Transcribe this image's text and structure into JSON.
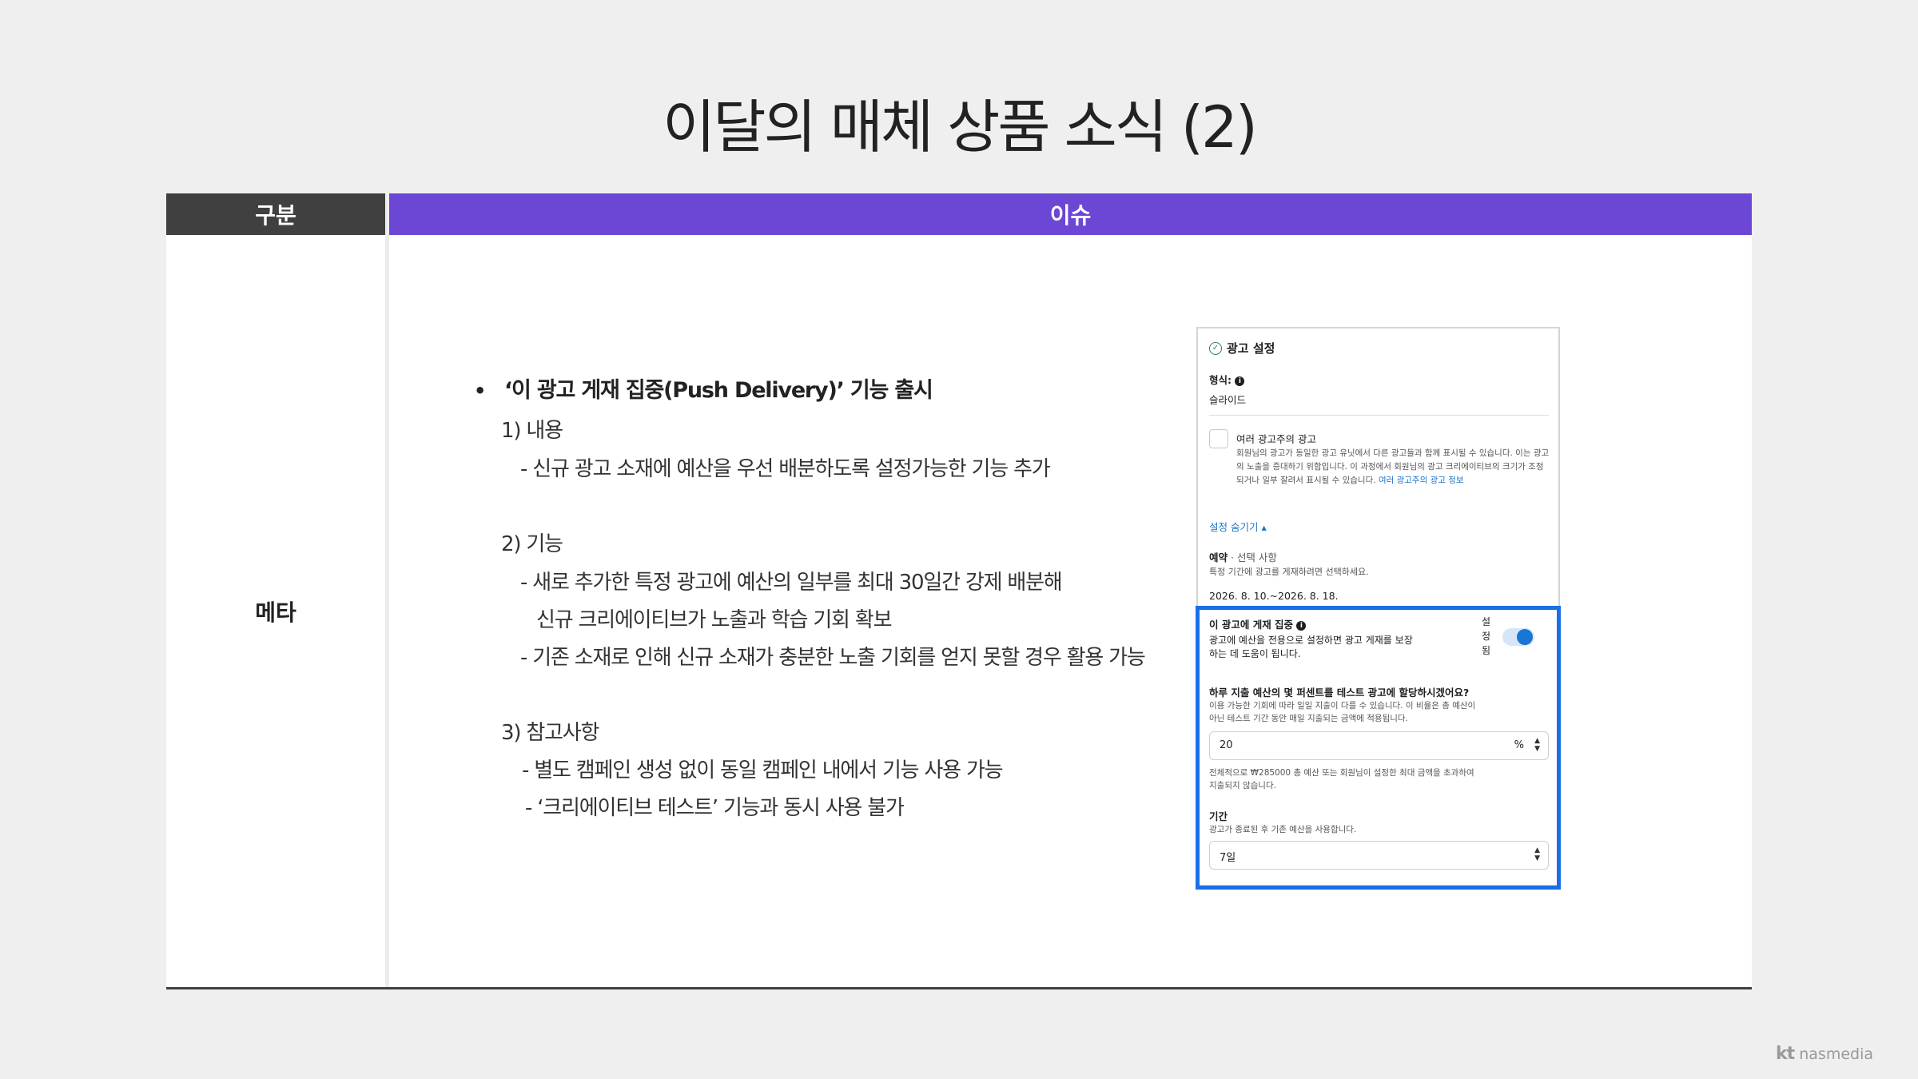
{
  "title": "이달의 매체 상품 소식 (2)",
  "table": {
    "header_left": "구분",
    "header_right": "이슈",
    "row_label": "메타"
  },
  "body": {
    "bullet_title": "‘이 광고 게재 집중(Push Delivery)’ 기능 출시",
    "sec1_title": "1) 내용",
    "sec1_item1": "- 신규 광고 소재에 예산을 우선 배분하도록 설정가능한 기능 추가",
    "sec2_title": "2) 기능",
    "sec2_item1a": "- 새로 추가한 특정 광고에 예산의 일부를 최대 30일간 강제 배분해",
    "sec2_item1b": "신규 크리에이티브가 노출과 학습 기회 확보",
    "sec2_item2": "- 기존 소재로 인해 신규 소재가 충분한 노출 기회를 얻지 못할 경우 활용 가능",
    "sec3_title": "3) 참고사항",
    "sec3_item1": "- 별도 캠페인 생성 없이 동일 캠페인 내에서 기능 사용 가능",
    "sec3_item2": "- ‘크리에이티브 테스트’ 기능과 동시 사용 불가"
  },
  "panel": {
    "heading": "광고 설정",
    "format_label": "형식:",
    "format_value": "슬라이드",
    "multi_adv_label": "여러 광고주의 광고",
    "multi_adv_desc": "회원님의 광고가 동일한 광고 유닛에서 다른 광고들과 함께 표시될 수 있습니다. 이는 광고의 노출을 증대하기 위함입니다. 이 과정에서 회원님의 광고 크리에이티브의 크기가 조정되거나 일부 잘려서 표시될 수 있습니다.",
    "multi_adv_link": "여러 광고주의 광고 정보",
    "hide_settings": "설정 숨기기 ▴",
    "schedule_label": "예약",
    "schedule_optional": " · 선택 사항",
    "schedule_desc": "특정 기간에 광고를 게재하려면 선택하세요.",
    "schedule_dates": "2026. 8. 10.~2026. 8. 18.",
    "push_label": "이 광고에 게재 집중",
    "push_desc_1": "광고에 예산을 전용으로 설정하면 광고 게재를 보장",
    "push_desc_2": "하는 데 도움이 됩니다.",
    "toggle_state": "설정됨",
    "toggle_c1": "설",
    "toggle_c2": "정",
    "toggle_c3": "됨",
    "percent_q": "하루 지출 예산의 몇 퍼센트를 테스트 광고에 할당하시겠어요?",
    "percent_desc_1": "이용 가능한 기회에 따라 일일 지출이 다를 수 있습니다. 이 비율은 총 예산이",
    "percent_desc_2": "아닌 테스트 기간 동안 매일 지출되는 금액에 적용됩니다.",
    "percent_value": "20",
    "percent_unit": "%",
    "total_note_1": "전체적으로 ₩285000 총 예산 또는 회원님이 설정한 최대 금액을 초과하여",
    "total_note_2": "지출되지 않습니다.",
    "duration_label": "기간",
    "duration_desc": "광고가 종료된 후 기존 예산을 사용합니다.",
    "duration_value": "7일"
  },
  "footer": {
    "logo_kt": "kt",
    "logo_name": "nasmedia"
  },
  "colors": {
    "header_left_bg": "#404040",
    "header_right_bg": "#6c47d6",
    "highlight_border": "#1a6fe6",
    "toggle_on": "#1877d2"
  }
}
